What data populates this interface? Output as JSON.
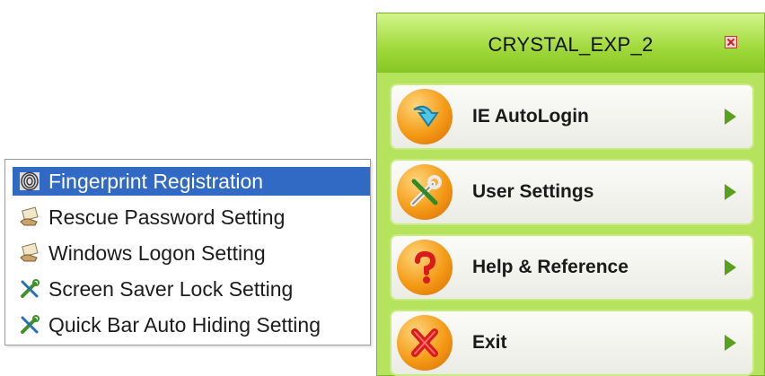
{
  "submenu": {
    "items": [
      {
        "label": "Fingerprint Registration",
        "icon": "fingerprint-icon",
        "selected": true
      },
      {
        "label": "Rescue Password Setting",
        "icon": "hand-card-icon",
        "selected": false
      },
      {
        "label": "Windows Logon Setting",
        "icon": "hand-card-icon",
        "selected": false
      },
      {
        "label": "Screen Saver Lock Setting",
        "icon": "tools-icon",
        "selected": false
      },
      {
        "label": "Quick Bar Auto Hiding Setting",
        "icon": "tools-icon",
        "selected": false
      }
    ]
  },
  "panel": {
    "title": "CRYSTAL_EXP_2",
    "buttons": [
      {
        "label": "IE AutoLogin",
        "icon": "download-arrow-icon"
      },
      {
        "label": "User Settings",
        "icon": "tools-icon"
      },
      {
        "label": "Help & Reference",
        "icon": "question-mark-icon"
      },
      {
        "label": "Exit",
        "icon": "red-x-icon"
      }
    ]
  },
  "colors": {
    "panel_green": "#b6e35e",
    "selection_blue": "#316ac5",
    "arrow_green": "#5aa01e",
    "close_red": "#c81e1e"
  }
}
